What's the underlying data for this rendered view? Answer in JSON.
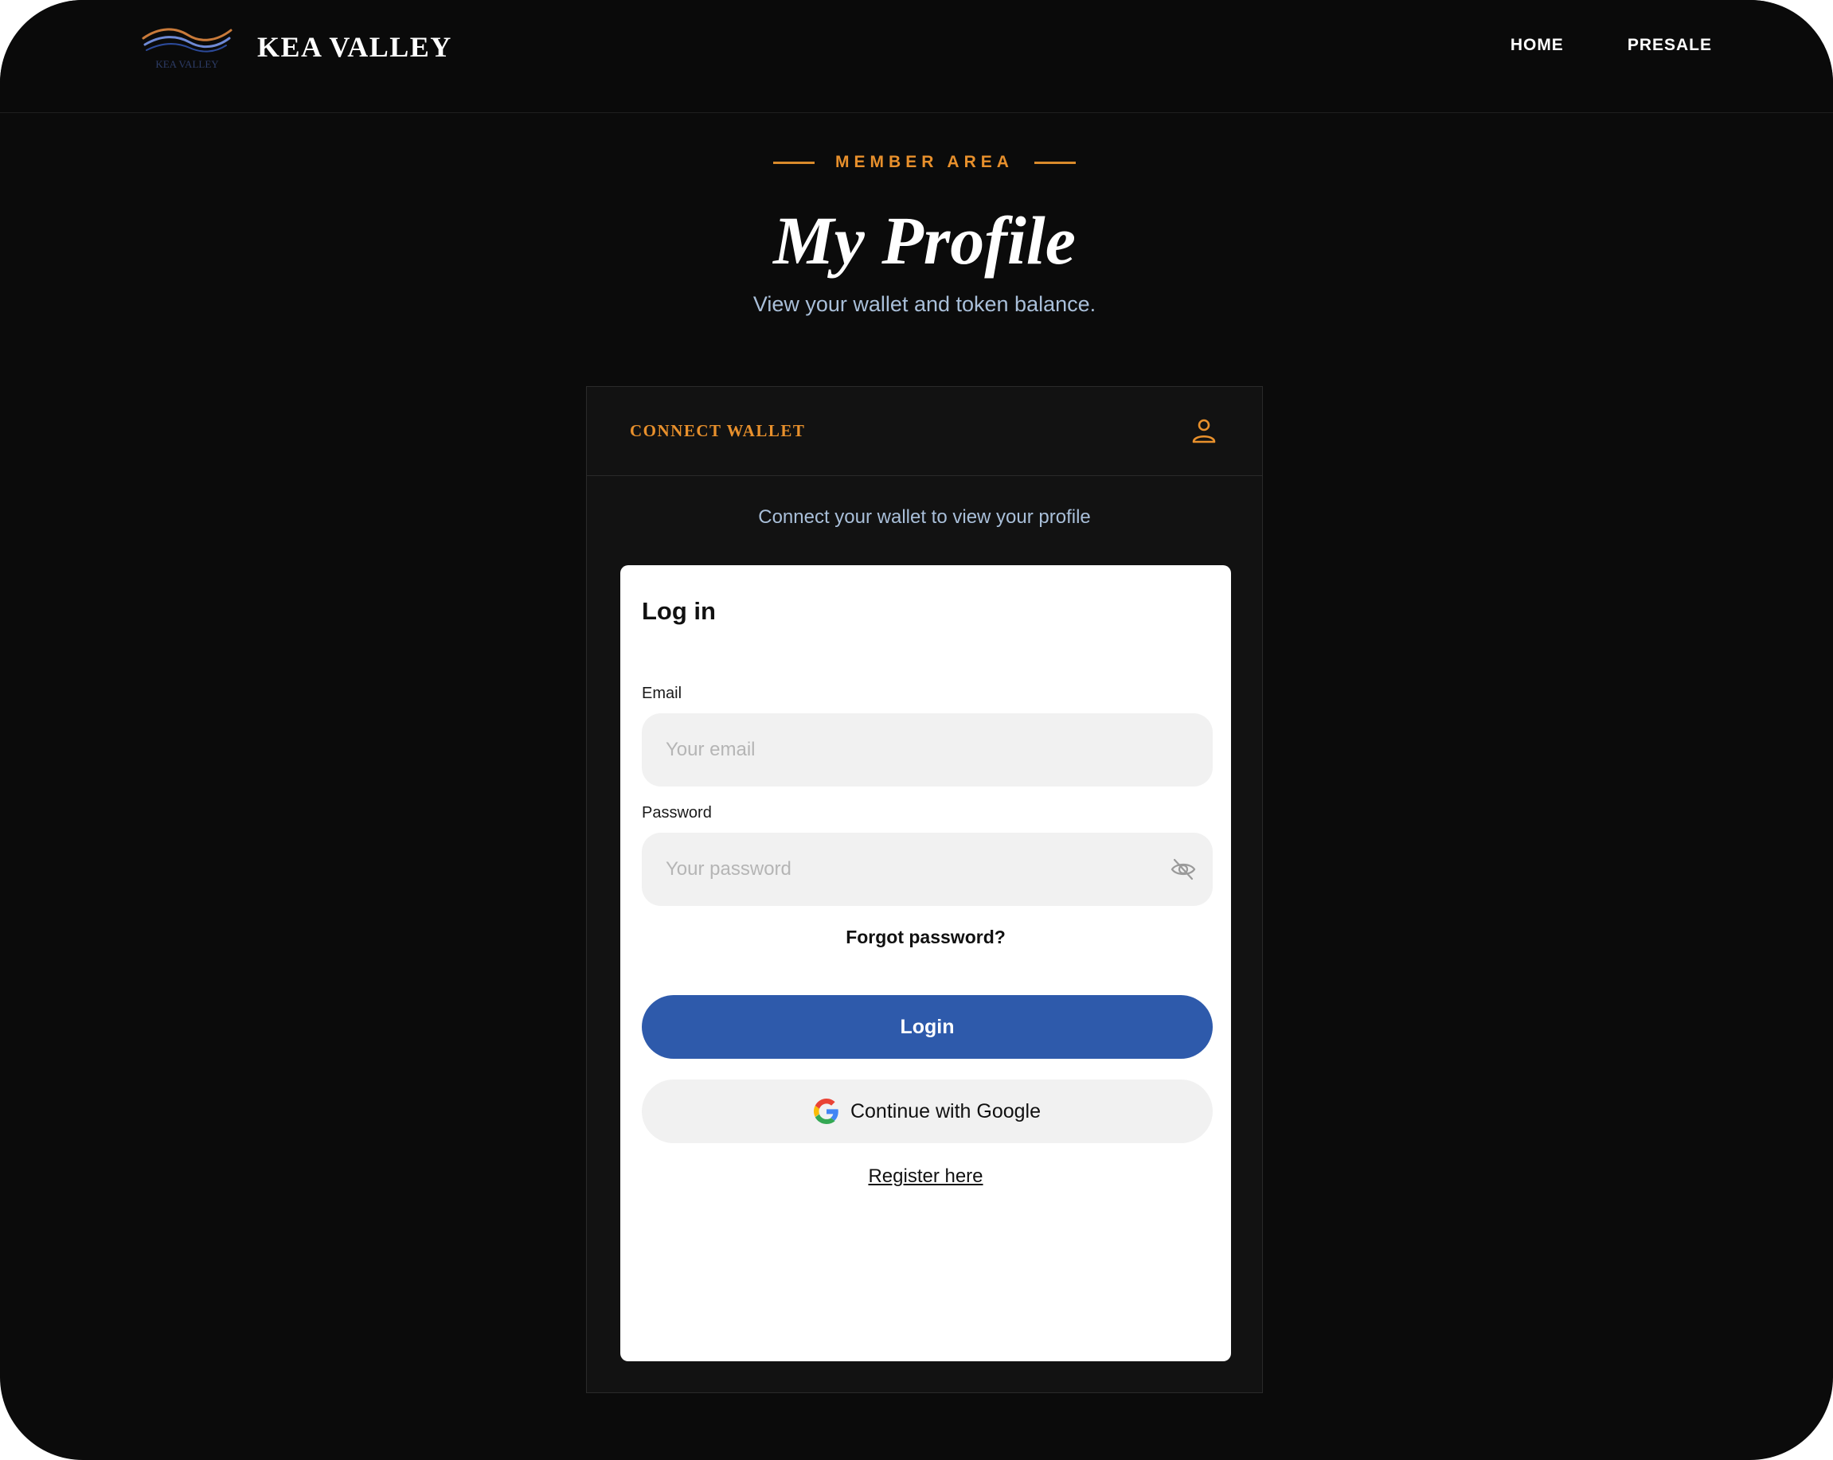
{
  "colors": {
    "background": "#0b0b0b",
    "accent_orange": "#e8902c",
    "subtitle_blue": "#a9bfd9",
    "primary_button": "#2e5aab",
    "input_bg": "#f1f1f1"
  },
  "header": {
    "logo_icon": "kea-valley-wave-logo",
    "logo_text": "KEA VALLEY",
    "brand_name": "KEA VALLEY",
    "nav": [
      "HOME",
      "PRESALE"
    ]
  },
  "hero": {
    "eyebrow": "MEMBER AREA",
    "title": "My Profile",
    "subtitle": "View your wallet and token balance."
  },
  "card": {
    "title": "CONNECT WALLET",
    "icon": "user-icon",
    "note": "Connect your wallet to view your profile"
  },
  "login": {
    "heading": "Log in",
    "email_label": "Email",
    "email_placeholder": "Your email",
    "email_value": "",
    "password_label": "Password",
    "password_placeholder": "Your password",
    "password_value": "",
    "password_toggle_icon": "eye-off-icon",
    "forgot": "Forgot password?",
    "login_button": "Login",
    "google_button": "Continue with Google",
    "google_icon": "google-icon",
    "register": "Register here"
  }
}
